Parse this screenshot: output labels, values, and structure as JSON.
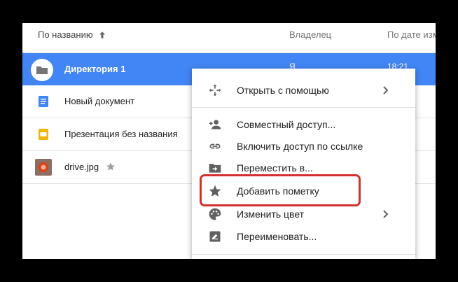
{
  "header": {
    "sort_by_name": "По названию",
    "owner": "Владелец",
    "date": "По дате изм"
  },
  "files": [
    {
      "name": "Директория 1",
      "type": "folder",
      "selected": true,
      "owner_fragment": "Я",
      "date_fragment": "18:21"
    },
    {
      "name": "Новый документ",
      "type": "document"
    },
    {
      "name": "Презентация без названия",
      "type": "presentation"
    },
    {
      "name": "drive.jpg",
      "type": "image",
      "starred": true
    }
  ],
  "context_menu": {
    "items": [
      {
        "label": "Открыть с помощью",
        "icon": "open-with-icon",
        "submenu": true
      },
      {
        "label": "Совместный доступ...",
        "icon": "add-person-icon"
      },
      {
        "label": "Включить доступ по ссылке",
        "icon": "link-icon"
      },
      {
        "label": "Переместить в...",
        "icon": "move-to-folder-icon"
      },
      {
        "label": "Добавить пометку",
        "icon": "star-icon",
        "highlighted": true
      },
      {
        "label": "Изменить цвет",
        "icon": "palette-icon",
        "submenu": true
      },
      {
        "label": "Переименовать...",
        "icon": "rename-icon"
      }
    ]
  },
  "colors": {
    "selection": "#4285f4",
    "document": "#4285f4",
    "presentation": "#f4b400",
    "highlight": "#d32f2f",
    "icon_gray": "#616161"
  }
}
